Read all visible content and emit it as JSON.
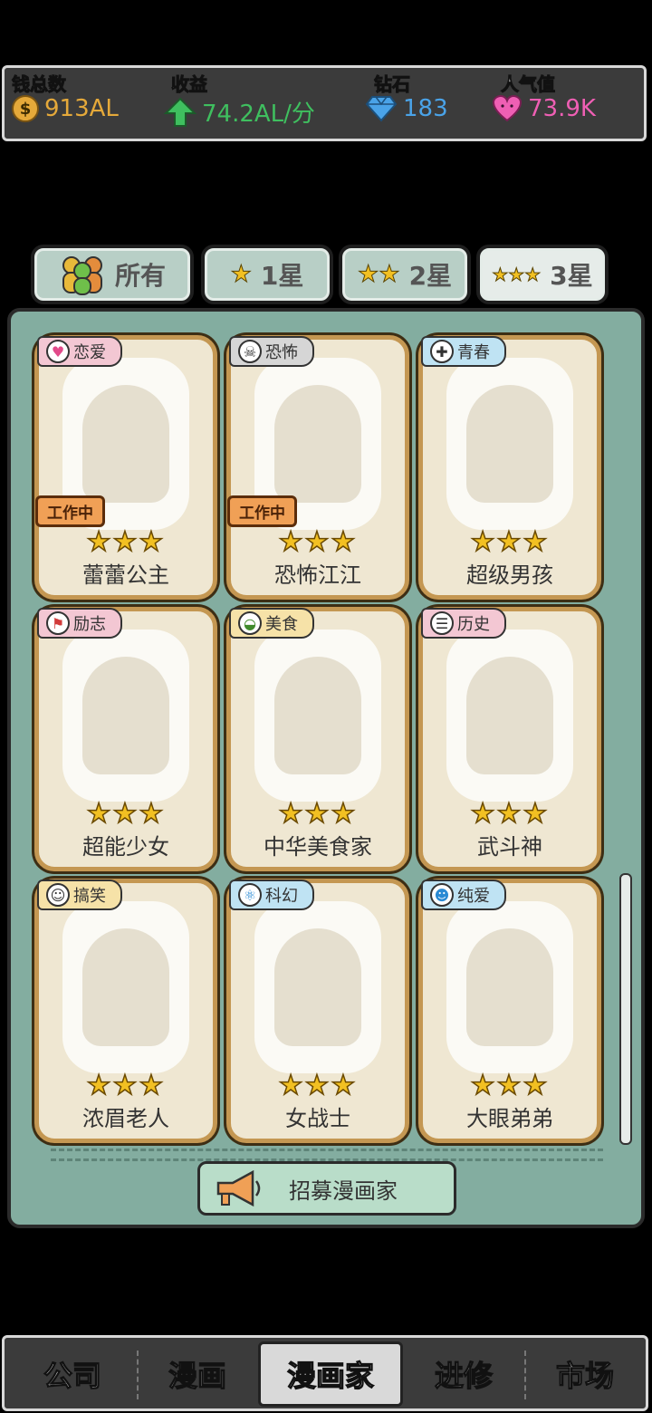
{
  "stats": {
    "money": {
      "label": "钱总数",
      "value": "913AL",
      "icon": "coin-icon",
      "color": "#e5a93a"
    },
    "income": {
      "label": "收益",
      "value": "74.2AL/分",
      "icon": "arrow-up-icon",
      "color": "#3fbf5f"
    },
    "diamonds": {
      "label": "钻石",
      "value": "183",
      "icon": "diamond-icon",
      "color": "#4aa3e8"
    },
    "popularity": {
      "label": "人气值",
      "value": "73.9K",
      "icon": "heart-icon",
      "color": "#ef5fb4"
    }
  },
  "tabs": [
    {
      "label": "所有",
      "icon": "people-icon"
    },
    {
      "label": "1星",
      "icon": "star-icon"
    },
    {
      "label": "2星",
      "icon": "two-stars-icon"
    },
    {
      "label": "3星",
      "icon": "three-stars-icon",
      "active": true
    }
  ],
  "cards": [
    {
      "genre": "恋爱",
      "genre_icon": "heart-icon",
      "genre_color": "#f3c7d3",
      "name": "蕾蕾公主",
      "stars": "★★★",
      "working": "工作中"
    },
    {
      "genre": "恐怖",
      "genre_icon": "skull-icon",
      "genre_color": "#d6d6d6",
      "name": "恐怖江江",
      "stars": "★★★",
      "working": "工作中"
    },
    {
      "genre": "青春",
      "genre_icon": "uniform-icon",
      "genre_color": "#bfe3f3",
      "name": "超级男孩",
      "stars": "★★★"
    },
    {
      "genre": "励志",
      "genre_icon": "flag-icon",
      "genre_color": "#f3c7d3",
      "name": "超能少女",
      "stars": "★★★"
    },
    {
      "genre": "美食",
      "genre_icon": "food-bowl-icon",
      "genre_color": "#f6e2a8",
      "name": "中华美食家",
      "stars": "★★★"
    },
    {
      "genre": "历史",
      "genre_icon": "scroll-icon",
      "genre_color": "#f3c7d3",
      "name": "武斗神",
      "stars": "★★★"
    },
    {
      "genre": "搞笑",
      "genre_icon": "laugh-icon",
      "genre_color": "#f6e2a8",
      "name": "浓眉老人",
      "stars": "★★★"
    },
    {
      "genre": "科幻",
      "genre_icon": "atom-icon",
      "genre_color": "#bfe3f3",
      "name": "女战士",
      "stars": "★★★"
    },
    {
      "genre": "纯爱",
      "genre_icon": "couple-icon",
      "genre_color": "#bfe3f3",
      "name": "大眼弟弟",
      "stars": "★★★"
    }
  ],
  "recruit": {
    "label": "招募漫画家",
    "icon": "megaphone-icon"
  },
  "nav": [
    {
      "label": "公司"
    },
    {
      "label": "漫画"
    },
    {
      "label": "漫画家",
      "active": true
    },
    {
      "label": "进修"
    },
    {
      "label": "市场"
    }
  ]
}
